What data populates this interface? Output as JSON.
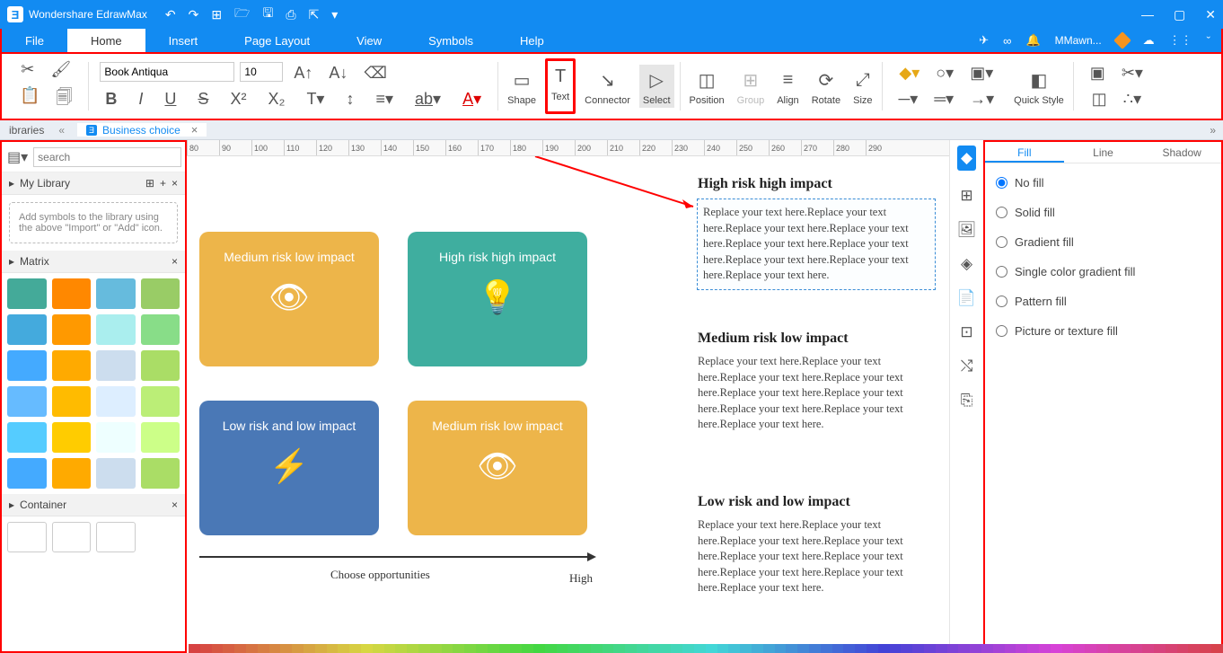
{
  "app": {
    "title": "Wondershare EdrawMax"
  },
  "menubar": {
    "tabs": [
      "File",
      "Home",
      "Insert",
      "Page Layout",
      "View",
      "Symbols",
      "Help"
    ],
    "active": 1,
    "user": "MMawn..."
  },
  "ribbon": {
    "font_name": "Book Antiqua",
    "font_size": "10",
    "buttons": {
      "shape": "Shape",
      "text": "Text",
      "connector": "Connector",
      "select": "Select",
      "position": "Position",
      "group": "Group",
      "align": "Align",
      "rotate": "Rotate",
      "size": "Size",
      "quick_style": "Quick Style"
    }
  },
  "doc": {
    "left_label": "ibraries",
    "tab_name": "Business choice"
  },
  "sidebar": {
    "search_placeholder": "search",
    "sections": {
      "my_library": "My Library",
      "matrix": "Matrix",
      "container": "Container"
    },
    "hint": "Add symbols to the library using the above \"Import\" or \"Add\" icon."
  },
  "canvas": {
    "ruler": [
      "80",
      "90",
      "100",
      "110",
      "120",
      "130",
      "140",
      "150",
      "160",
      "170",
      "180",
      "190",
      "200",
      "210",
      "220",
      "230",
      "240",
      "250",
      "260",
      "270",
      "280",
      "290"
    ],
    "cards": {
      "c1": "Medium risk low impact",
      "c2": "High risk high impact",
      "c3": "Low risk and low impact",
      "c4": "Medium risk low impact"
    },
    "axis": {
      "x_label": "Choose opportunities",
      "x_end": "High"
    },
    "texts": {
      "t1_h": "High risk high impact",
      "t2_h": "Medium risk low impact",
      "t3_h": "Low risk and low impact",
      "body": "Replace your text here.Replace your text here.Replace your text here.Replace your text here.Replace your text here.Replace your text here.Replace your text here.Replace your text here.Replace your text here."
    }
  },
  "rightpanel": {
    "tabs": [
      "Fill",
      "Line",
      "Shadow"
    ],
    "active": 0,
    "options": [
      "No fill",
      "Solid fill",
      "Gradient fill",
      "Single color gradient fill",
      "Pattern fill",
      "Picture or texture fill"
    ],
    "selected": 0
  },
  "thumb_colors": [
    "#4a9",
    "#f80",
    "#6bd",
    "#9c6",
    "#4ad",
    "#f90",
    "#aee",
    "#8d8",
    "#4af",
    "#fa0",
    "#cde",
    "#ad6",
    "#6bf",
    "#fb0",
    "#def",
    "#be7",
    "#5cf",
    "#fc0",
    "#eff",
    "#cf8",
    "#4af",
    "#fa0",
    "#cde",
    "#ad6"
  ]
}
